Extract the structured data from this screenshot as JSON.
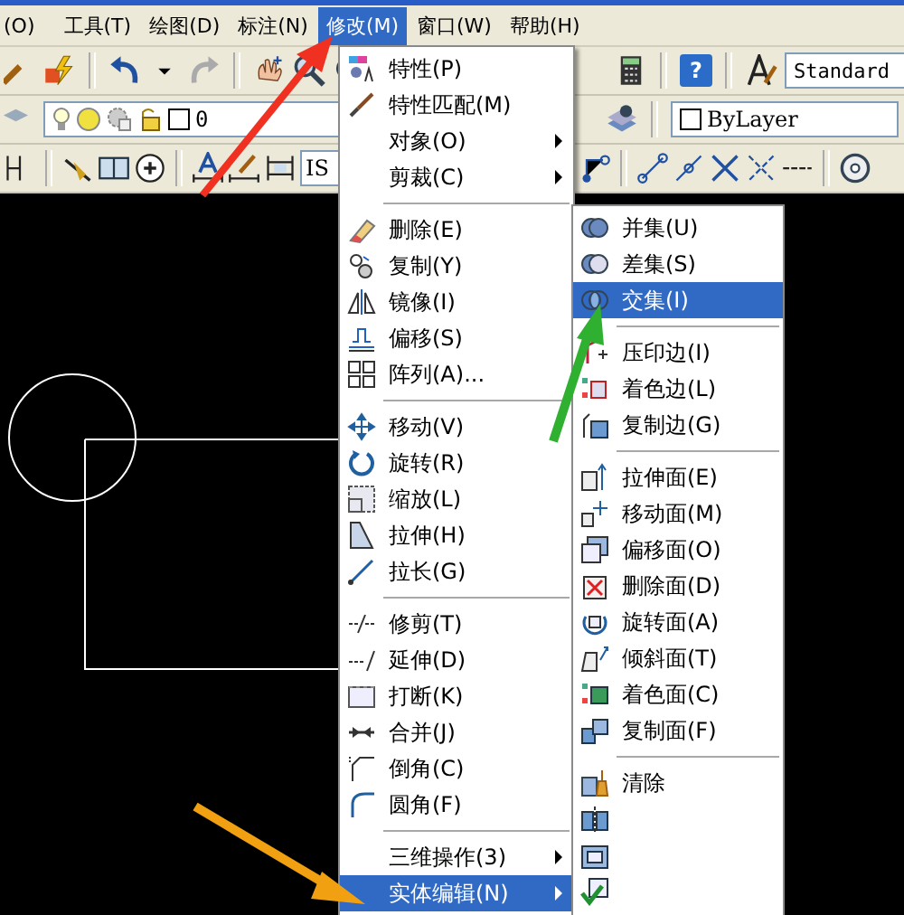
{
  "menubar": [
    {
      "label": "(O)",
      "selected": false
    },
    {
      "label": "工具(T)",
      "selected": false
    },
    {
      "label": "绘图(D)",
      "selected": false
    },
    {
      "label": "标注(N)",
      "selected": false
    },
    {
      "label": "修改(M)",
      "selected": true
    },
    {
      "label": "窗口(W)",
      "selected": false
    },
    {
      "label": "帮助(H)",
      "selected": false
    }
  ],
  "toolbars": {
    "help_glyph": "?",
    "text_style": "Standard",
    "layer": "0",
    "linetype": "ByLayer",
    "dim_style": "IS"
  },
  "modify_menu": {
    "items": [
      {
        "kind": "item",
        "label": "特性(P)",
        "submenu": false,
        "selected": false
      },
      {
        "kind": "item",
        "label": "特性匹配(M)",
        "submenu": false,
        "selected": false
      },
      {
        "kind": "item",
        "label": "对象(O)",
        "submenu": true,
        "selected": false
      },
      {
        "kind": "item",
        "label": "剪裁(C)",
        "submenu": true,
        "selected": false
      },
      {
        "kind": "separator"
      },
      {
        "kind": "item",
        "label": "删除(E)",
        "submenu": false,
        "selected": false
      },
      {
        "kind": "item",
        "label": "复制(Y)",
        "submenu": false,
        "selected": false
      },
      {
        "kind": "item",
        "label": "镜像(I)",
        "submenu": false,
        "selected": false
      },
      {
        "kind": "item",
        "label": "偏移(S)",
        "submenu": false,
        "selected": false
      },
      {
        "kind": "item",
        "label": "阵列(A)...",
        "submenu": false,
        "selected": false
      },
      {
        "kind": "separator"
      },
      {
        "kind": "item",
        "label": "移动(V)",
        "submenu": false,
        "selected": false
      },
      {
        "kind": "item",
        "label": "旋转(R)",
        "submenu": false,
        "selected": false
      },
      {
        "kind": "item",
        "label": "缩放(L)",
        "submenu": false,
        "selected": false
      },
      {
        "kind": "item",
        "label": "拉伸(H)",
        "submenu": false,
        "selected": false
      },
      {
        "kind": "item",
        "label": "拉长(G)",
        "submenu": false,
        "selected": false
      },
      {
        "kind": "separator"
      },
      {
        "kind": "item",
        "label": "修剪(T)",
        "submenu": false,
        "selected": false
      },
      {
        "kind": "item",
        "label": "延伸(D)",
        "submenu": false,
        "selected": false
      },
      {
        "kind": "item",
        "label": "打断(K)",
        "submenu": false,
        "selected": false
      },
      {
        "kind": "item",
        "label": "合并(J)",
        "submenu": false,
        "selected": false
      },
      {
        "kind": "item",
        "label": "倒角(C)",
        "submenu": false,
        "selected": false
      },
      {
        "kind": "item",
        "label": "圆角(F)",
        "submenu": false,
        "selected": false
      },
      {
        "kind": "separator"
      },
      {
        "kind": "item",
        "label": "三维操作(3)",
        "submenu": true,
        "selected": false
      },
      {
        "kind": "item",
        "label": "实体编辑(N)",
        "submenu": true,
        "selected": true
      }
    ]
  },
  "solid_edit_menu": {
    "items": [
      {
        "kind": "item",
        "label": "并集(U)",
        "selected": false
      },
      {
        "kind": "item",
        "label": "差集(S)",
        "selected": false
      },
      {
        "kind": "item",
        "label": "交集(I)",
        "selected": true
      },
      {
        "kind": "separator"
      },
      {
        "kind": "item",
        "label": "压印边(I)",
        "selected": false
      },
      {
        "kind": "item",
        "label": "着色边(L)",
        "selected": false
      },
      {
        "kind": "item",
        "label": "复制边(G)",
        "selected": false
      },
      {
        "kind": "separator"
      },
      {
        "kind": "item",
        "label": "拉伸面(E)",
        "selected": false
      },
      {
        "kind": "item",
        "label": "移动面(M)",
        "selected": false
      },
      {
        "kind": "item",
        "label": "偏移面(O)",
        "selected": false
      },
      {
        "kind": "item",
        "label": "删除面(D)",
        "selected": false
      },
      {
        "kind": "item",
        "label": "旋转面(A)",
        "selected": false
      },
      {
        "kind": "item",
        "label": "倾斜面(T)",
        "selected": false
      },
      {
        "kind": "item",
        "label": "着色面(C)",
        "selected": false
      },
      {
        "kind": "item",
        "label": "复制面(F)",
        "selected": false
      },
      {
        "kind": "separator"
      },
      {
        "kind": "item",
        "label": "清除",
        "selected": false
      },
      {
        "kind": "icon_only",
        "selected": false
      },
      {
        "kind": "icon_only",
        "selected": false
      },
      {
        "kind": "icon_only",
        "selected": false
      }
    ]
  }
}
